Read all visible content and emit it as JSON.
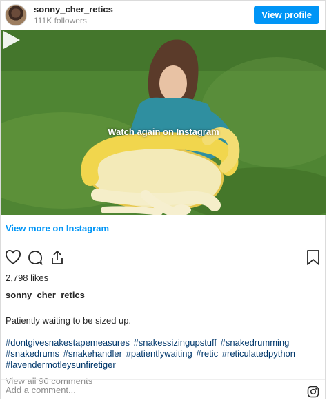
{
  "header": {
    "username": "sonny_cher_retics",
    "followers": "111K followers",
    "view_profile_label": "View profile"
  },
  "media": {
    "overlay_text": "Watch again on Instagram"
  },
  "view_more_label": "View more on Instagram",
  "actions": {
    "icons": [
      "heart-icon",
      "comment-icon",
      "share-icon",
      "bookmark-icon"
    ]
  },
  "likes": "2,798 likes",
  "caption": {
    "username": "sonny_cher_retics",
    "text": "Patiently waiting to be sized up.",
    "hashtags": [
      "#dontgivesnakestapemeasures",
      "#snakessizingupstuff",
      "#snakedrumming",
      "#snakedrums",
      "#snakehandler",
      "#patientlywaiting",
      "#retic",
      "#reticulatedpython",
      "#lavendermotleysunfiretiger"
    ]
  },
  "view_comments": "View all 90 comments",
  "comment_input": {
    "placeholder": "Add a comment..."
  },
  "colors": {
    "accent": "#0095f6",
    "link": "#00376b",
    "muted": "#8e8e8e"
  }
}
